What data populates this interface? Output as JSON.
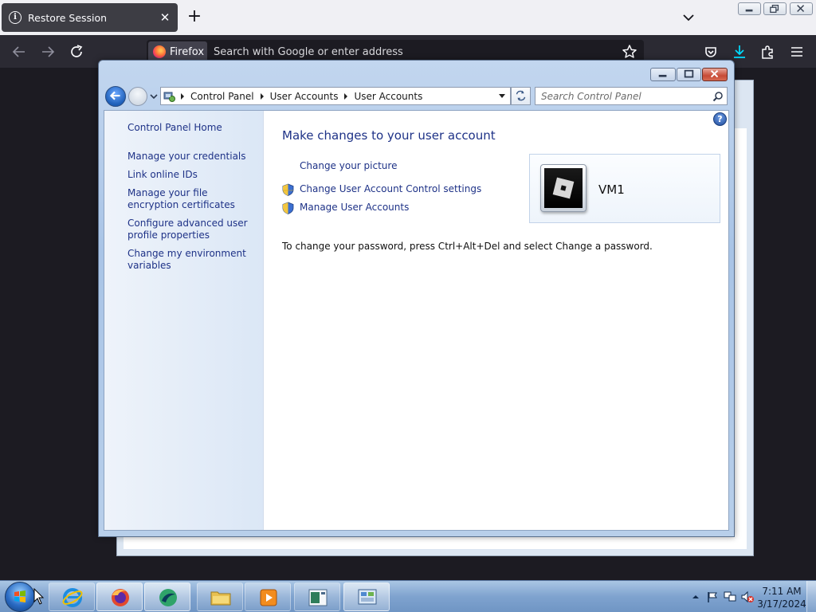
{
  "browser": {
    "tab_title": "Restore Session",
    "identity_label": "Firefox",
    "url_placeholder": "Search with Google or enter address"
  },
  "control_panel": {
    "breadcrumbs": [
      "Control Panel",
      "User Accounts",
      "User Accounts"
    ],
    "search_placeholder": "Search Control Panel",
    "sidebar": {
      "home": "Control Panel Home",
      "links": [
        "Manage your credentials",
        "Link online IDs",
        "Manage your file encryption certificates",
        "Configure advanced user profile properties",
        "Change my environment variables"
      ]
    },
    "heading": "Make changes to your user account",
    "tasks": {
      "change_picture": "Change your picture",
      "uac_settings": "Change User Account Control settings",
      "manage_accounts": "Manage User Accounts"
    },
    "note": "To change your password, press Ctrl+Alt+Del and select Change a password.",
    "user": {
      "name": "VM1"
    },
    "help_glyph": "?"
  },
  "taskbar": {
    "items": [
      {
        "name": "internet-explorer",
        "state": "pinned"
      },
      {
        "name": "firefox",
        "state": "active"
      },
      {
        "name": "app",
        "state": "active"
      },
      {
        "name": "windows-explorer",
        "state": "pinned"
      },
      {
        "name": "media-player",
        "state": "pinned"
      },
      {
        "name": "app-window",
        "state": "pinned"
      },
      {
        "name": "control-panel",
        "state": "active"
      }
    ],
    "clock": {
      "time": "7:11 AM",
      "date": "3/17/2024"
    }
  },
  "colors": {
    "link": "#1e3287",
    "firefox_toolbar": "#2b2a33",
    "taskbar": "#7fa3cf"
  }
}
